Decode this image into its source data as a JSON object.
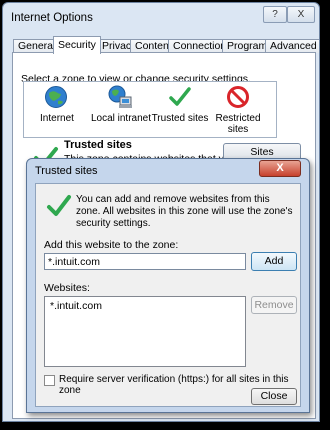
{
  "internet_options": {
    "title": "Internet Options",
    "help_button": "?",
    "close_button": "X",
    "tabs": [
      {
        "label": "General"
      },
      {
        "label": "Security"
      },
      {
        "label": "Privacy"
      },
      {
        "label": "Content"
      },
      {
        "label": "Connections"
      },
      {
        "label": "Programs"
      },
      {
        "label": "Advanced"
      }
    ],
    "active_tab": "Security",
    "zone_prompt": "Select a zone to view or change security settings.",
    "zones": [
      {
        "label": "Internet",
        "icon": "globe-icon"
      },
      {
        "label": "Local intranet",
        "icon": "local-intranet-icon"
      },
      {
        "label": "Trusted sites",
        "icon": "checkmark-icon"
      },
      {
        "label": "Restricted sites",
        "icon": "restricted-icon"
      }
    ],
    "selected_zone_title": "Trusted sites",
    "selected_zone_desc": "This zone contains websites that you",
    "sites_button": "Sites"
  },
  "trusted_sites_dialog": {
    "title": "Trusted sites",
    "close_button": "X",
    "info_text": "You can add and remove websites from this zone. All websites in this zone will use the zone's security settings.",
    "add_label": "Add this website to the zone:",
    "add_input_value": "*.intuit.com",
    "add_button": "Add",
    "websites_label": "Websites:",
    "websites": [
      "*.intuit.com"
    ],
    "remove_button": "Remove",
    "require_verification_label": "Require server verification (https:) for all sites in this zone",
    "require_verification_checked": false,
    "close_label": "Close"
  },
  "colors": {
    "window_frame": "#dbe6f3",
    "dialog_frame": "#c5d6ec",
    "checkmark": "#2fa84f",
    "restricted": "#d9252a"
  }
}
